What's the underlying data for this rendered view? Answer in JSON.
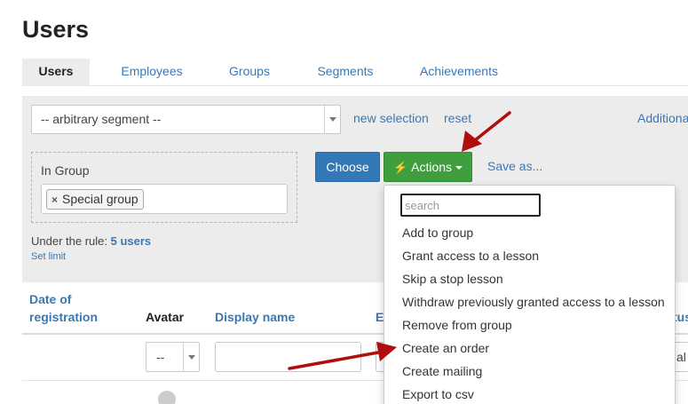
{
  "page": {
    "title": "Users"
  },
  "tabs": [
    {
      "label": "Users",
      "active": true
    },
    {
      "label": "Employees",
      "active": false
    },
    {
      "label": "Groups",
      "active": false
    },
    {
      "label": "Segments",
      "active": false
    },
    {
      "label": "Achievements",
      "active": false
    }
  ],
  "filter": {
    "segment_value": "-- arbitrary segment --",
    "new_selection": "new selection",
    "reset": "reset",
    "additional": "Additional",
    "group_label": "In Group",
    "group_tag": "Special group",
    "tag_remove_symbol": "×",
    "choose_label": "Choose",
    "actions_label": "Actions",
    "save_as": "Save as...",
    "rule_prefix": "Under the rule:",
    "rule_count": "5 users",
    "set_limit": "Set limit"
  },
  "table": {
    "headers": {
      "date_line1": "Date of",
      "date_line2": "registration",
      "avatar": "Avatar",
      "display_name": "Display name",
      "email_partial": "E",
      "status_partial": "tus"
    },
    "avatar_filter_value": "--",
    "status_filter_partial": "al"
  },
  "dropdown": {
    "search_placeholder": "search",
    "items": [
      "Add to group",
      "Grant access to a lesson",
      "Skip a stop lesson",
      "Withdraw previously granted access to a lesson",
      "Remove from group",
      "Create an order",
      "Create mailing",
      "Export to csv"
    ]
  },
  "colors": {
    "primary_button": "#3479b7",
    "success_button": "#3f9f3f",
    "link": "#3a78b5",
    "annotation_arrow": "#b00d0d"
  }
}
